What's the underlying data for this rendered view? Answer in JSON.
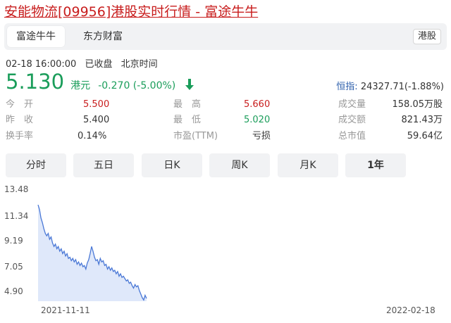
{
  "title": "安能物流[09956]港股实时行情 - 富途牛牛",
  "tabs": [
    {
      "label": "富途牛牛",
      "active": true
    },
    {
      "label": "东方财富",
      "active": false
    }
  ],
  "market_tag": "港股",
  "meta": {
    "datetime": "02-18 16:00:00",
    "status": "已收盘",
    "timezone": "北京时间"
  },
  "quote": {
    "price": "5.130",
    "currency": "港元",
    "change": "-0.270 (-5.00%)",
    "direction": "down"
  },
  "index": {
    "label": "恒指:",
    "value": "24327.71(-1.88%)"
  },
  "stats": {
    "open": {
      "label": "今　开",
      "value": "5.500"
    },
    "prev_close": {
      "label": "昨　收",
      "value": "5.400"
    },
    "turnover_rate": {
      "label": "换手率",
      "value": "0.14%"
    },
    "high": {
      "label": "最　高",
      "value": "5.660"
    },
    "low": {
      "label": "最　低",
      "value": "5.020"
    },
    "pe": {
      "label": "市盈(TTM)",
      "value": "亏损"
    },
    "volume": {
      "label": "成交量",
      "value": "158.05万股"
    },
    "amount": {
      "label": "成交额",
      "value": "821.43万"
    },
    "mktcap": {
      "label": "总市值",
      "value": "59.64亿"
    }
  },
  "periods": [
    {
      "label": "分时",
      "active": false
    },
    {
      "label": "五日",
      "active": false
    },
    {
      "label": "日K",
      "active": false
    },
    {
      "label": "周K",
      "active": false
    },
    {
      "label": "月K",
      "active": false
    },
    {
      "label": "1年",
      "active": true
    }
  ],
  "colors": {
    "up": "#c81d1d",
    "down": "#1a9d5a",
    "line": "#4a78d6",
    "fill": "#dfe8fa"
  },
  "chart_data": {
    "type": "area",
    "x_labels": [
      "2021-11-11",
      "2022-02-18"
    ],
    "y_ticks": [
      "13.48",
      "11.34",
      "9.19",
      "7.05",
      "4.90"
    ],
    "ylim": [
      4.9,
      13.48
    ],
    "grid": false,
    "series": [
      {
        "values": [
          13.0,
          12.6,
          11.9,
          11.5,
          11.0,
          10.6,
          10.4,
          10.6,
          10.1,
          10.3,
          9.8,
          9.5,
          9.7,
          9.3,
          9.5,
          9.1,
          9.3,
          8.9,
          9.1,
          8.7,
          8.9,
          8.5,
          8.6,
          8.3,
          8.5,
          8.2,
          8.4,
          8.0,
          8.2,
          7.9,
          8.1,
          7.8,
          7.9,
          7.6,
          8.1,
          8.4,
          8.9,
          9.5,
          9.1,
          8.6,
          8.3,
          8.4,
          8.0,
          8.5,
          8.2,
          8.3,
          7.9,
          8.0,
          7.6,
          7.8,
          7.5,
          7.7,
          7.4,
          7.5,
          7.2,
          7.4,
          7.0,
          7.2,
          6.9,
          7.0,
          6.8,
          6.6,
          6.7,
          6.4,
          6.5,
          6.2,
          6.0,
          6.3,
          6.1,
          6.2,
          5.8,
          5.5,
          5.2,
          5.0,
          5.4,
          5.13
        ]
      }
    ]
  }
}
